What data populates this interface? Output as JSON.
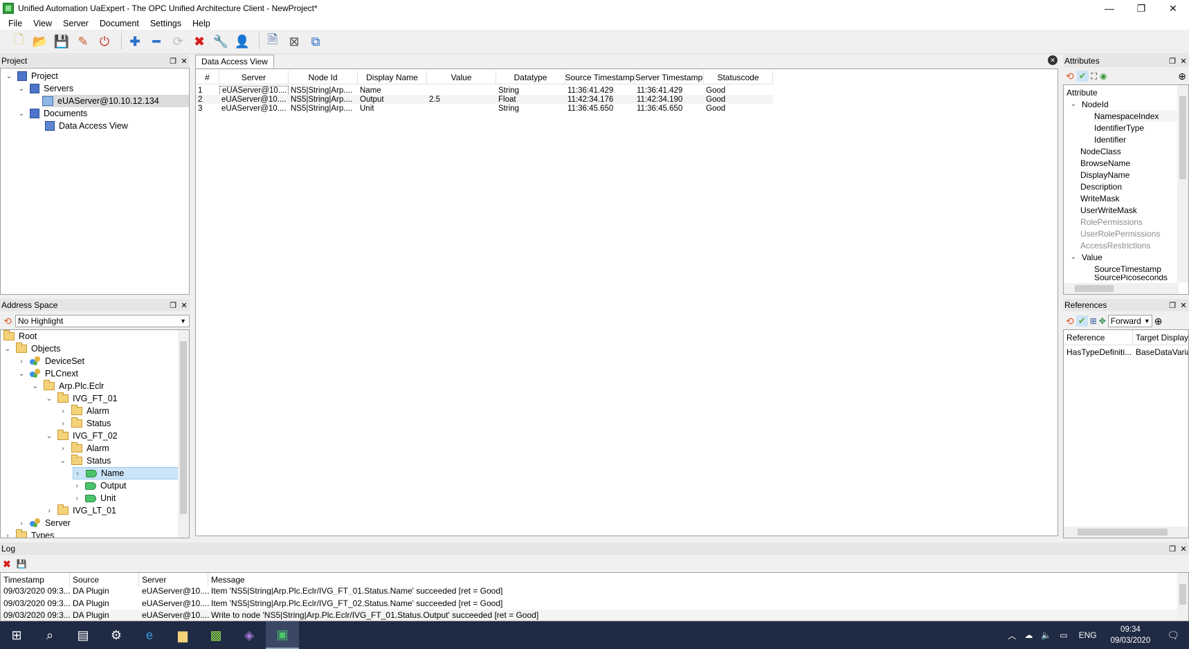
{
  "window": {
    "title": "Unified Automation UaExpert - The OPC Unified Architecture Client - NewProject*",
    "minimize": "—",
    "maximize": "❐",
    "close": "✕"
  },
  "menu": [
    "File",
    "View",
    "Server",
    "Document",
    "Settings",
    "Help"
  ],
  "project": {
    "title": "Project",
    "items": [
      "Project",
      "Servers",
      "eUAServer@10.10.12.134",
      "Documents",
      "Data Access View"
    ]
  },
  "address_space": {
    "title": "Address Space",
    "highlight": "No Highlight",
    "items": [
      "Root",
      "Objects",
      "DeviceSet",
      "PLCnext",
      "Arp.Plc.Eclr",
      "IVG_FT_01",
      "Alarm",
      "Status",
      "IVG_FT_02",
      "Alarm",
      "Status",
      "Name",
      "Output",
      "Unit",
      "IVG_LT_01",
      "Server",
      "Types"
    ]
  },
  "dav": {
    "tab": "Data Access View",
    "columns": [
      "#",
      "Server",
      "Node Id",
      "Display Name",
      "Value",
      "Datatype",
      "Source Timestamp",
      "Server Timestamp",
      "Statuscode"
    ],
    "rows": [
      [
        "1",
        "eUAServer@10....",
        "NS5|String|Arp....",
        "Name",
        "",
        "String",
        "11:36:41.429",
        "11:36:41.429",
        "Good"
      ],
      [
        "2",
        "eUAServer@10....",
        "NS5|String|Arp....",
        "Output",
        "2.5",
        "Float",
        "11:42:34.176",
        "11:42:34.190",
        "Good"
      ],
      [
        "3",
        "eUAServer@10....",
        "NS5|String|Arp....",
        "Unit",
        "",
        "String",
        "11:36:45.650",
        "11:36:45.650",
        "Good"
      ]
    ]
  },
  "attributes": {
    "title": "Attributes",
    "header": "Attribute",
    "items": [
      "NodeId",
      "NamespaceIndex",
      "IdentifierType",
      "Identifier",
      "NodeClass",
      "BrowseName",
      "DisplayName",
      "Description",
      "WriteMask",
      "UserWriteMask",
      "RolePermissions",
      "UserRolePermissions",
      "AccessRestrictions",
      "Value",
      "SourceTimestamp",
      "SourcePicoseconds"
    ]
  },
  "references": {
    "title": "References",
    "direction": "Forward",
    "columns": [
      "Reference",
      "Target Display"
    ],
    "rows": [
      [
        "HasTypeDefiniti...",
        "BaseDataVarial"
      ]
    ]
  },
  "log": {
    "title": "Log",
    "columns": [
      "Timestamp",
      "Source",
      "Server",
      "Message"
    ],
    "rows": [
      [
        "09/03/2020 09:3...",
        "DA Plugin",
        "eUAServer@10....",
        "Item 'NS5|String|Arp.Plc.Eclr/IVG_FT_01.Status.Name' succeeded [ret = Good]"
      ],
      [
        "09/03/2020 09:3...",
        "DA Plugin",
        "eUAServer@10....",
        "Item 'NS5|String|Arp.Plc.Eclr/IVG_FT_02.Status.Name' succeeded [ret = Good]"
      ],
      [
        "09/03/2020 09:3...",
        "DA Plugin",
        "eUAServer@10....",
        "Write to node 'NS5|String|Arp.Plc.Eclr/IVG_FT_01.Status.Output' succeeded [ret = Good]"
      ]
    ]
  },
  "taskbar": {
    "lang": "ENG",
    "time": "09:34",
    "date": "09/03/2020"
  }
}
